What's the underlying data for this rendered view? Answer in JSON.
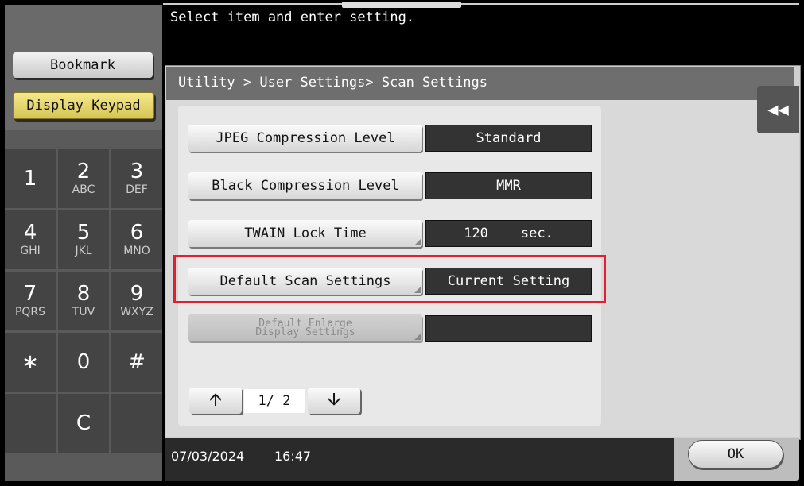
{
  "header": {
    "message": "Select item and enter setting."
  },
  "left": {
    "bookmark_label": "Bookmark",
    "display_keypad_label": "Display Keypad"
  },
  "keypad": {
    "keys": [
      {
        "digit": "1",
        "letters": ""
      },
      {
        "digit": "2",
        "letters": "ABC"
      },
      {
        "digit": "3",
        "letters": "DEF"
      },
      {
        "digit": "4",
        "letters": "GHI"
      },
      {
        "digit": "5",
        "letters": "JKL"
      },
      {
        "digit": "6",
        "letters": "MNO"
      },
      {
        "digit": "7",
        "letters": "PQRS"
      },
      {
        "digit": "8",
        "letters": "TUV"
      },
      {
        "digit": "9",
        "letters": "WXYZ"
      },
      {
        "digit": "∗",
        "letters": ""
      },
      {
        "digit": "0",
        "letters": ""
      },
      {
        "digit": "#",
        "letters": ""
      },
      {
        "digit": "",
        "letters": ""
      },
      {
        "digit": "C",
        "letters": ""
      },
      {
        "digit": "",
        "letters": ""
      }
    ]
  },
  "dialog": {
    "breadcrumb": "Utility > User Settings> Scan Settings",
    "back_icon": "double-left-arrow-icon",
    "settings": [
      {
        "label": "JPEG Compression Level",
        "value": "Standard"
      },
      {
        "label": "Black Compression Level",
        "value": "MMR"
      },
      {
        "label": "TWAIN Lock Time",
        "value": "120    sec."
      },
      {
        "label": "Default Scan Settings",
        "value": "Current Setting"
      },
      {
        "label_line1": "Default Enlarge",
        "label_line2": "Display Settings",
        "value": ""
      }
    ],
    "pager": {
      "page": "1/ 2",
      "up_icon": "arrow-up-icon",
      "down_icon": "arrow-down-icon"
    }
  },
  "status": {
    "date": "07/03/2024",
    "time": "16:47",
    "ok_label": "OK"
  },
  "colors": {
    "highlight": "#e02030",
    "keypad_button": "#f6e98a"
  }
}
